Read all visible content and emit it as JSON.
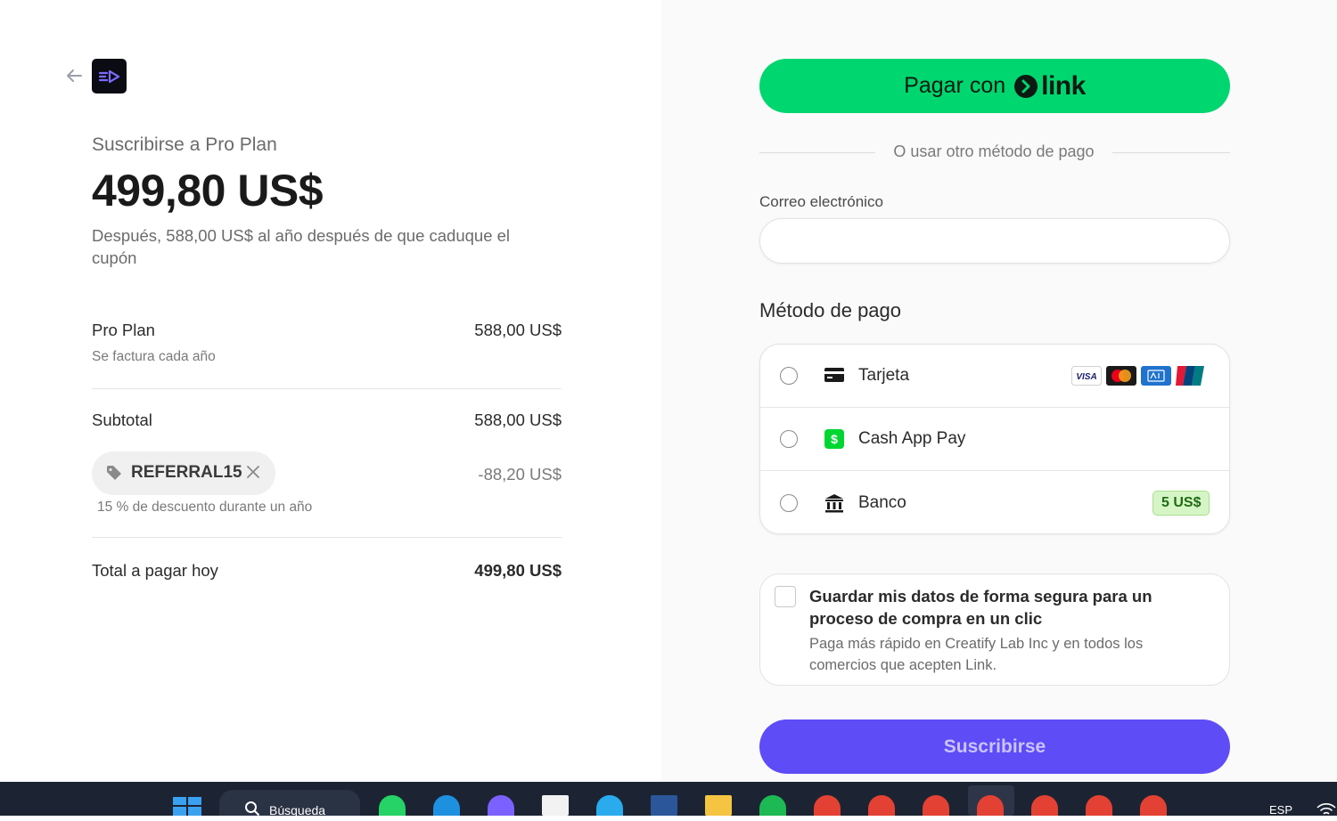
{
  "summary": {
    "title": "Suscribirse a Pro Plan",
    "price": "499,80 US$",
    "after_note": "Después, 588,00 US$ al año después de que caduque el cupón",
    "plan_name": "Pro Plan",
    "plan_billing": "Se factura cada año",
    "plan_price": "588,00 US$",
    "subtotal_label": "Subtotal",
    "subtotal_value": "588,00 US$",
    "coupon_code": "REFERRAL15",
    "coupon_discount": "-88,20 US$",
    "coupon_note": "15 % de descuento durante un año",
    "total_label": "Total a pagar hoy",
    "total_value": "499,80 US$"
  },
  "payment": {
    "link_button_prefix": "Pagar con",
    "link_brand": "link",
    "or_text": "O usar otro método de pago",
    "email_label": "Correo electrónico",
    "email_value": "",
    "method_title": "Método de pago",
    "methods": [
      {
        "label": "Tarjeta",
        "icon": "credit-card-icon",
        "brands": [
          "VISA",
          "mastercard",
          "amex",
          "unionpay"
        ]
      },
      {
        "label": "Cash App Pay",
        "icon": "cash-app-icon"
      },
      {
        "label": "Banco",
        "icon": "bank-icon",
        "badge": "5 US$"
      }
    ],
    "save_title": "Guardar mis datos de forma segura para un proceso de compra en un clic",
    "save_desc": "Paga más rápido en Creatify Lab Inc y en todos los comercios que acepten Link.",
    "subscribe_label": "Suscribirse"
  },
  "taskbar": {
    "search_label": "Búsqueda",
    "language": "ESP"
  },
  "colors": {
    "link_green": "#00d66f",
    "subscribe_purple": "#5e4cf7",
    "bank_badge_bg": "#d6f5c6"
  }
}
